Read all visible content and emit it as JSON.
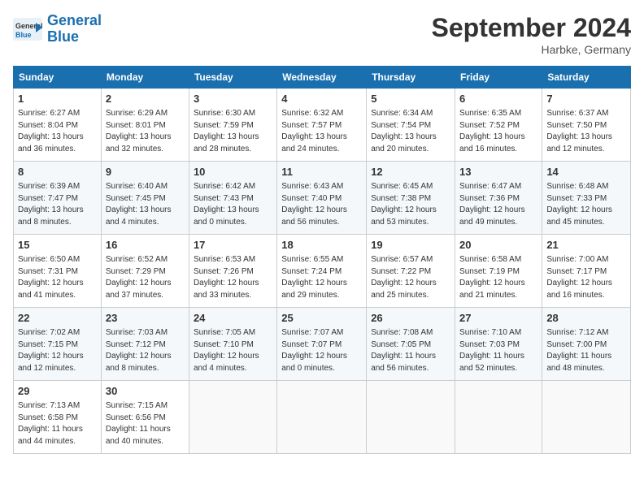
{
  "header": {
    "logo_text_general": "General",
    "logo_text_blue": "Blue",
    "month": "September 2024",
    "location": "Harbke, Germany"
  },
  "columns": [
    "Sunday",
    "Monday",
    "Tuesday",
    "Wednesday",
    "Thursday",
    "Friday",
    "Saturday"
  ],
  "weeks": [
    [
      {
        "day": "1",
        "detail": "Sunrise: 6:27 AM\nSunset: 8:04 PM\nDaylight: 13 hours\nand 36 minutes."
      },
      {
        "day": "2",
        "detail": "Sunrise: 6:29 AM\nSunset: 8:01 PM\nDaylight: 13 hours\nand 32 minutes."
      },
      {
        "day": "3",
        "detail": "Sunrise: 6:30 AM\nSunset: 7:59 PM\nDaylight: 13 hours\nand 28 minutes."
      },
      {
        "day": "4",
        "detail": "Sunrise: 6:32 AM\nSunset: 7:57 PM\nDaylight: 13 hours\nand 24 minutes."
      },
      {
        "day": "5",
        "detail": "Sunrise: 6:34 AM\nSunset: 7:54 PM\nDaylight: 13 hours\nand 20 minutes."
      },
      {
        "day": "6",
        "detail": "Sunrise: 6:35 AM\nSunset: 7:52 PM\nDaylight: 13 hours\nand 16 minutes."
      },
      {
        "day": "7",
        "detail": "Sunrise: 6:37 AM\nSunset: 7:50 PM\nDaylight: 13 hours\nand 12 minutes."
      }
    ],
    [
      {
        "day": "8",
        "detail": "Sunrise: 6:39 AM\nSunset: 7:47 PM\nDaylight: 13 hours\nand 8 minutes."
      },
      {
        "day": "9",
        "detail": "Sunrise: 6:40 AM\nSunset: 7:45 PM\nDaylight: 13 hours\nand 4 minutes."
      },
      {
        "day": "10",
        "detail": "Sunrise: 6:42 AM\nSunset: 7:43 PM\nDaylight: 13 hours\nand 0 minutes."
      },
      {
        "day": "11",
        "detail": "Sunrise: 6:43 AM\nSunset: 7:40 PM\nDaylight: 12 hours\nand 56 minutes."
      },
      {
        "day": "12",
        "detail": "Sunrise: 6:45 AM\nSunset: 7:38 PM\nDaylight: 12 hours\nand 53 minutes."
      },
      {
        "day": "13",
        "detail": "Sunrise: 6:47 AM\nSunset: 7:36 PM\nDaylight: 12 hours\nand 49 minutes."
      },
      {
        "day": "14",
        "detail": "Sunrise: 6:48 AM\nSunset: 7:33 PM\nDaylight: 12 hours\nand 45 minutes."
      }
    ],
    [
      {
        "day": "15",
        "detail": "Sunrise: 6:50 AM\nSunset: 7:31 PM\nDaylight: 12 hours\nand 41 minutes."
      },
      {
        "day": "16",
        "detail": "Sunrise: 6:52 AM\nSunset: 7:29 PM\nDaylight: 12 hours\nand 37 minutes."
      },
      {
        "day": "17",
        "detail": "Sunrise: 6:53 AM\nSunset: 7:26 PM\nDaylight: 12 hours\nand 33 minutes."
      },
      {
        "day": "18",
        "detail": "Sunrise: 6:55 AM\nSunset: 7:24 PM\nDaylight: 12 hours\nand 29 minutes."
      },
      {
        "day": "19",
        "detail": "Sunrise: 6:57 AM\nSunset: 7:22 PM\nDaylight: 12 hours\nand 25 minutes."
      },
      {
        "day": "20",
        "detail": "Sunrise: 6:58 AM\nSunset: 7:19 PM\nDaylight: 12 hours\nand 21 minutes."
      },
      {
        "day": "21",
        "detail": "Sunrise: 7:00 AM\nSunset: 7:17 PM\nDaylight: 12 hours\nand 16 minutes."
      }
    ],
    [
      {
        "day": "22",
        "detail": "Sunrise: 7:02 AM\nSunset: 7:15 PM\nDaylight: 12 hours\nand 12 minutes."
      },
      {
        "day": "23",
        "detail": "Sunrise: 7:03 AM\nSunset: 7:12 PM\nDaylight: 12 hours\nand 8 minutes."
      },
      {
        "day": "24",
        "detail": "Sunrise: 7:05 AM\nSunset: 7:10 PM\nDaylight: 12 hours\nand 4 minutes."
      },
      {
        "day": "25",
        "detail": "Sunrise: 7:07 AM\nSunset: 7:07 PM\nDaylight: 12 hours\nand 0 minutes."
      },
      {
        "day": "26",
        "detail": "Sunrise: 7:08 AM\nSunset: 7:05 PM\nDaylight: 11 hours\nand 56 minutes."
      },
      {
        "day": "27",
        "detail": "Sunrise: 7:10 AM\nSunset: 7:03 PM\nDaylight: 11 hours\nand 52 minutes."
      },
      {
        "day": "28",
        "detail": "Sunrise: 7:12 AM\nSunset: 7:00 PM\nDaylight: 11 hours\nand 48 minutes."
      }
    ],
    [
      {
        "day": "29",
        "detail": "Sunrise: 7:13 AM\nSunset: 6:58 PM\nDaylight: 11 hours\nand 44 minutes."
      },
      {
        "day": "30",
        "detail": "Sunrise: 7:15 AM\nSunset: 6:56 PM\nDaylight: 11 hours\nand 40 minutes."
      },
      {
        "day": "",
        "detail": ""
      },
      {
        "day": "",
        "detail": ""
      },
      {
        "day": "",
        "detail": ""
      },
      {
        "day": "",
        "detail": ""
      },
      {
        "day": "",
        "detail": ""
      }
    ]
  ]
}
